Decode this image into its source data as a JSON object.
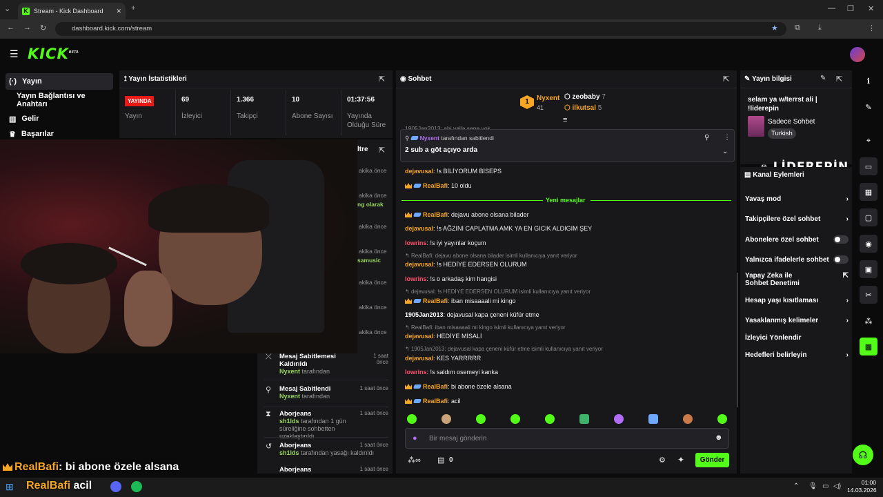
{
  "browser": {
    "tab_title": "Stream - Kick Dashboard",
    "url": "dashboard.kick.com/stream"
  },
  "header": {
    "logo": "KICK",
    "beta": "BETA"
  },
  "sidebar": {
    "items": [
      {
        "label": "Yayın",
        "icon": "broadcast-icon"
      },
      {
        "label": "Yayın Bağlantısı ve Anahtarı",
        "icon": ""
      },
      {
        "label": "Gelir",
        "icon": "chart-icon"
      },
      {
        "label": "Başarılar",
        "icon": "trophy-icon"
      }
    ]
  },
  "stats": {
    "title": "Yayın İstatistikleri",
    "live_badge": "YAYINDA",
    "status_label": "Yayın",
    "items": [
      {
        "value": "69",
        "label": "İzleyici"
      },
      {
        "value": "1.366",
        "label": "Takipçi"
      },
      {
        "value": "10",
        "label": "Abone Sayısı"
      },
      {
        "value": "01:37:56",
        "label": "Yayında Olduğu Süre"
      }
    ]
  },
  "activity": {
    "title_fragment": "ltre",
    "times": [
      "akika önce",
      "akika önce",
      "akika önce",
      "akika önce",
      "akika önce",
      "akika önce",
      "akika önce"
    ],
    "fragments": [
      "ng olarak",
      "samusic"
    ],
    "items": [
      {
        "title": "Mesaj Sabitlemesi Kaldırıldı",
        "user": "Nyxent",
        "suffix": "tarafından",
        "time": "1 saat önce",
        "icon": "unpin-icon"
      },
      {
        "title": "Mesaj Sabitlendi",
        "user": "Nyxent",
        "suffix": "tarafından",
        "time": "1 saat önce",
        "icon": "pin-icon"
      },
      {
        "title": "Aborjeans",
        "user": "sh1lds",
        "suffix": "tarafından 1 gün süreliğine sohbetten uzaklaştırıldı",
        "time": "1 saat önce",
        "icon": "hourglass-icon"
      },
      {
        "title": "Aborjeans",
        "user": "sh1lds",
        "suffix": "tarafından yasağı kaldırıldı",
        "time": "1 saat önce",
        "icon": "undo-icon"
      },
      {
        "title": "Aborjeans",
        "user": "",
        "suffix": "",
        "time": "1 saat önce",
        "icon": ""
      }
    ]
  },
  "chat": {
    "title": "Sohbet",
    "leaders": [
      {
        "rank": "1",
        "name": "Nyxent",
        "count": "41"
      },
      {
        "name": "zeobaby",
        "count": "7"
      },
      {
        "name": "ilkutsal",
        "count": "5"
      }
    ],
    "partial_line": "1905Jan2013: abi valla sene yok",
    "pinned": {
      "by_user": "Nyxent",
      "by_suffix": "tarafından sabitlendi",
      "text": "2 sub a göt açıyo arda"
    },
    "new_messages": "Yeni mesajlar",
    "messages": [
      {
        "user": "dejavusal",
        "text": ": !s BİLİYORUM BİSEPS",
        "color": "orange"
      },
      {
        "user": "RealBafi",
        "text": ": 10 oldu",
        "color": "orange",
        "badges": true
      },
      {
        "user": "RealBafi",
        "text": ": dejavu abone olsana bilader",
        "color": "orange",
        "badges": true
      },
      {
        "user": "dejavusal",
        "text": ": !s AĞZINI CAPLATMA AMK YA EN GICIK ALDIGIM ŞEY",
        "color": "orange"
      },
      {
        "user": "lowrins",
        "text": ": !s iyi yayınlar koçum",
        "color": "pink"
      },
      {
        "reply": "RealBafi: dejavu abone olsana bilader isimli kullanıcıya yanıt veriyor"
      },
      {
        "user": "dejavusal",
        "text": ": !s HEDİYE EDERSEN OLURUM",
        "color": "orange"
      },
      {
        "user": "lowrins",
        "text": ": !s o arkadaş kim hangisi",
        "color": "pink"
      },
      {
        "reply": "dejavusal: !s HEDİYE EDERSEN OLURUM isimli kullanıcıya yanıt veriyor"
      },
      {
        "user": "RealBafi",
        "text": ": iban misaaaali mi kingo",
        "color": "orange",
        "badges": true
      },
      {
        "user": "1905Jan2013",
        "text": ": dejavusal kapa çeneni küfür etme",
        "color": "white"
      },
      {
        "reply": "RealBafi: iban misaaaali mi kingo isimli kullanıcıya yanıt veriyor"
      },
      {
        "user": "dejavusal",
        "text": ": HEDİYE MİSALİ",
        "color": "orange"
      },
      {
        "reply": "1905Jan2013: dejavusal kapa çeneni küfür etme isimli kullanıcıya yanıt veriyor"
      },
      {
        "user": "dejavusal",
        "text": ": KES YARRRRR",
        "color": "orange"
      },
      {
        "user": "lowrins",
        "text": ": !s saldım osemeyi kanka",
        "color": "pink"
      },
      {
        "user": "RealBafi",
        "text": ": bi abone özele alsana",
        "color": "orange",
        "badges": true
      },
      {
        "user": "RealBafi",
        "text": ": acil",
        "color": "orange",
        "badges": true
      }
    ],
    "input_placeholder": "Bir mesaj gönderin",
    "points": "0",
    "send": "Gönder"
  },
  "stream_info": {
    "title": "Yayın bilgisi",
    "stream_title": "selam ya w/terrst ali | !liderepin",
    "category": "Sadece Sohbet",
    "tag": "Turkish"
  },
  "watermark": "LİDEREPİN",
  "channel_actions": {
    "title": "Kanal Eylemleri",
    "items": [
      {
        "label": "Yavaş mod",
        "type": "chevron"
      },
      {
        "label": "Takipçilere özel sohbet",
        "type": "chevron"
      },
      {
        "label": "Abonelere özel sohbet",
        "type": "toggle"
      },
      {
        "label": "Yalnızca ifadelerle sohbet",
        "type": "toggle"
      },
      {
        "label": "Yapay Zeka ile Sohbet Denetimi",
        "type": "external"
      },
      {
        "label": "Hesap yaşı kısıtlaması",
        "type": "chevron"
      },
      {
        "label": "Yasaklanmış kelimeler",
        "type": "chevron"
      },
      {
        "label": "İzleyici Yönlendir",
        "type": "none"
      },
      {
        "label": "Hedefleri belirleyin",
        "type": "chevron"
      }
    ]
  },
  "overlay": {
    "user": "RealBafi",
    "text": ": bi abone özele alsana",
    "user2": "RealBafi",
    "text2": "acil"
  },
  "taskbar": {
    "time": "01:00",
    "date": "14.03.2026"
  },
  "colors": {
    "accent": "#53fc18",
    "panel": "#18181b",
    "bg": "#0b0b0c"
  }
}
